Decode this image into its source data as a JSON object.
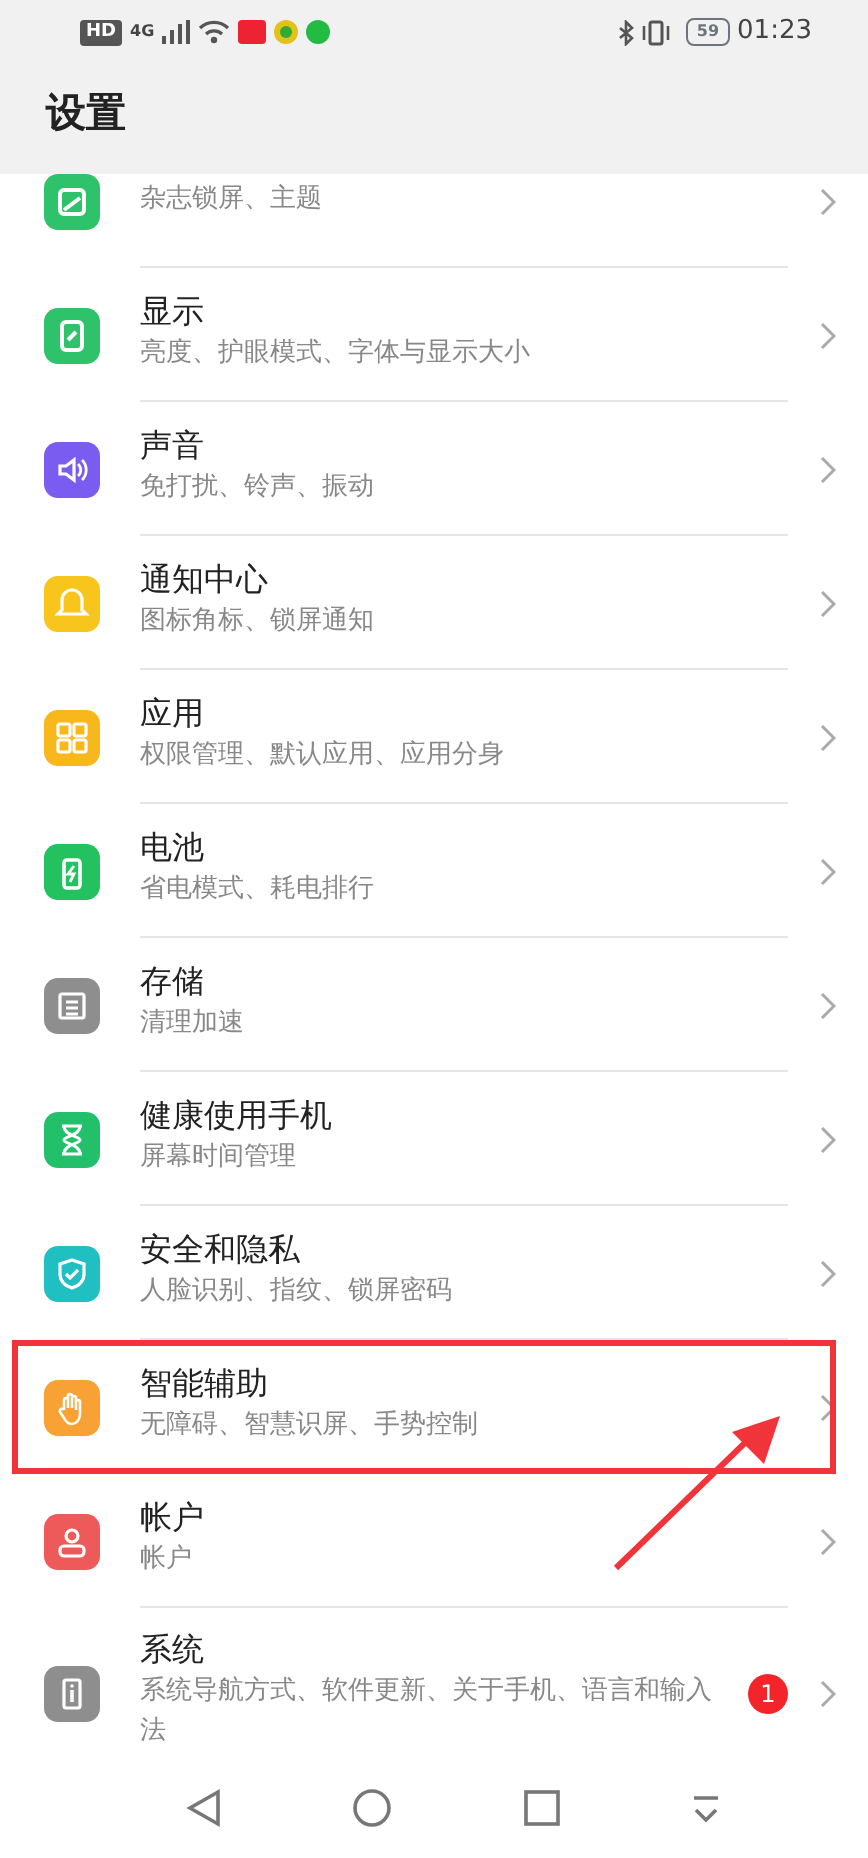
{
  "status_bar": {
    "hd": "HD",
    "network": "4G",
    "battery": "59",
    "time": "01:23"
  },
  "header": {
    "title": "设置"
  },
  "rows": [
    {
      "kind": "partial",
      "subtitle": "杂志锁屏、主题",
      "color": "#2ec36b",
      "highlighted": false
    },
    {
      "kind": "full",
      "title": "显示",
      "subtitle": "亮度、护眼模式、字体与显示大小",
      "color": "#2ec36b",
      "highlighted": false
    },
    {
      "kind": "full",
      "title": "声音",
      "subtitle": "免打扰、铃声、振动",
      "color": "#7b5cf0",
      "highlighted": false
    },
    {
      "kind": "full",
      "title": "通知中心",
      "subtitle": "图标角标、锁屏通知",
      "color": "#f8c51c",
      "highlighted": false
    },
    {
      "kind": "full",
      "title": "应用",
      "subtitle": "权限管理、默认应用、应用分身",
      "color": "#f8b81c",
      "highlighted": false
    },
    {
      "kind": "full",
      "title": "电池",
      "subtitle": "省电模式、耗电排行",
      "color": "#23c160",
      "highlighted": false
    },
    {
      "kind": "full",
      "title": "存储",
      "subtitle": "清理加速",
      "color": "#8e8e8e",
      "highlighted": false
    },
    {
      "kind": "full",
      "title": "健康使用手机",
      "subtitle": "屏幕时间管理",
      "color": "#22c06a",
      "highlighted": false
    },
    {
      "kind": "full",
      "title": "安全和隐私",
      "subtitle": "人脸识别、指纹、锁屏密码",
      "color": "#1fbfc2",
      "highlighted": false
    },
    {
      "kind": "full",
      "title": "智能辅助",
      "subtitle": "无障碍、智慧识屏、手势控制",
      "color": "#f8a235",
      "highlighted": true
    },
    {
      "kind": "full",
      "title": "帐户",
      "subtitle": "帐户",
      "color": "#ee5a5a",
      "highlighted": false
    },
    {
      "kind": "full",
      "title": "系统",
      "subtitle": "系统导航方式、软件更新、关于手机、语言和输入法",
      "color": "#8e8e8e",
      "highlighted": false,
      "badge": "1"
    }
  ]
}
